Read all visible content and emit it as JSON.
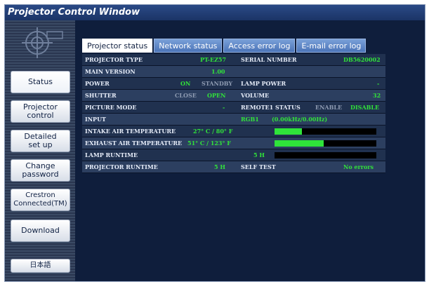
{
  "window": {
    "title": "Projector Control Window"
  },
  "sidebar": {
    "logo_icon": "projector-logo-icon",
    "buttons": [
      {
        "label": "Status"
      },
      {
        "label": "Projector\ncontrol"
      },
      {
        "label": "Detailed\nset up"
      },
      {
        "label": "Change\npassword"
      },
      {
        "label": "Crestron\nConnected(TM)"
      },
      {
        "label": "Download"
      },
      {
        "label": "日本語"
      }
    ]
  },
  "tabs": [
    {
      "label": "Projector status",
      "active": true
    },
    {
      "label": "Network status",
      "active": false
    },
    {
      "label": "Access error log",
      "active": false
    },
    {
      "label": "E-mail error log",
      "active": false
    }
  ],
  "status": {
    "projector_type_label": "PROJECTOR TYPE",
    "projector_type_value": "PT-EZ57",
    "serial_label": "SERIAL NUMBER",
    "serial_value": "DB5620002",
    "main_version_label": "MAIN VERSION",
    "main_version_value": "1.00",
    "power_label": "POWER",
    "power_on": "ON",
    "power_standby": "STANDBY",
    "lamp_power_label": "LAMP POWER",
    "lamp_power_value": "-",
    "shutter_label": "SHUTTER",
    "shutter_close": "CLOSE",
    "shutter_open": "OPEN",
    "volume_label": "VOLUME",
    "volume_value": "32",
    "picture_mode_label": "PICTURE MODE",
    "picture_mode_value": "-",
    "remote1_label": "REMOTE1 STATUS",
    "remote1_enable": "ENABLE",
    "remote1_disable": "DISABLE",
    "input_label": "INPUT",
    "input_value": "RGB1",
    "input_freq": "(0.00kHz/0.00Hz)",
    "intake_label": "INTAKE AIR TEMPERATURE",
    "intake_value": "27° C / 80° F",
    "intake_level": 0.27,
    "exhaust_label": "EXHAUST AIR TEMPERATURE",
    "exhaust_value": "51° C / 123° F",
    "exhaust_level": 0.48,
    "lamp_runtime_label": "LAMP RUNTIME",
    "lamp_runtime_value": "5 H",
    "lamp_runtime_level": 0.0,
    "projector_runtime_label": "PROJECTOR RUNTIME",
    "projector_runtime_value": "5 H",
    "self_test_label": "SELF TEST",
    "self_test_value": "No errors"
  },
  "colors": {
    "status_green": "#31e23a",
    "inactive_gray": "#8e9bb2"
  }
}
